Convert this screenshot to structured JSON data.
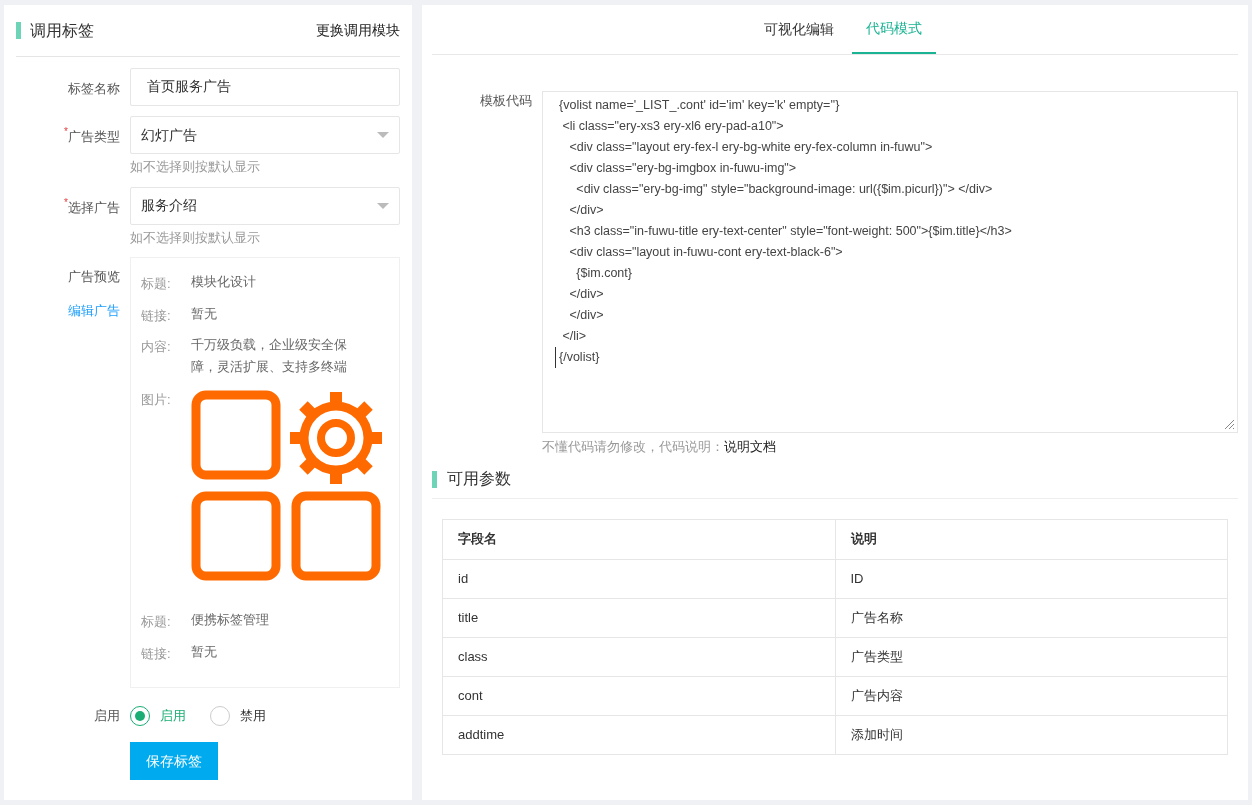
{
  "left_panel": {
    "title": "调用标签",
    "switch_link": "更换调用模块",
    "fields": [
      {
        "kind": "input",
        "label": "标签名称",
        "value": "首页服务广告"
      },
      {
        "kind": "select",
        "label": "广告类型",
        "mark": "*",
        "value": "幻灯广告",
        "hint": "如不选择则按默认显示"
      },
      {
        "kind": "select",
        "label": "选择广告",
        "mark": "*",
        "value": "服务介绍",
        "hint": "如不选择则按默认显示"
      }
    ],
    "preview": {
      "label": "广告预览",
      "edit_link": "编辑广告",
      "items": [
        {
          "kind": "text",
          "label": "标题:",
          "value": "模块化设计"
        },
        {
          "kind": "text",
          "label": "链接:",
          "value": "暂无"
        },
        {
          "kind": "text",
          "label": "内容:",
          "value": "千万级负载，企业级安全保障，灵活扩展、支持多终端"
        },
        {
          "kind": "image",
          "label": "图片:"
        },
        {
          "kind": "text",
          "label": "标题:",
          "value": "便携标签管理"
        },
        {
          "kind": "text",
          "label": "链接:",
          "value": "暂无"
        }
      ]
    },
    "status": {
      "label": "启用",
      "options": [
        {
          "label": "启用",
          "selected": true
        },
        {
          "label": "禁用",
          "selected": false
        }
      ]
    },
    "save_button": "保存标签"
  },
  "right_panel": {
    "tabs": [
      {
        "label": "可视化编辑",
        "selected": false
      },
      {
        "label": "代码模式",
        "selected": true
      }
    ],
    "code_label": "模板代码",
    "code_lines": [
      "{volist name='_LIST_.cont' id='im' key='k' empty=''}",
      " <li class=\"ery-xs3 ery-xl6 ery-pad-a10\">",
      "   <div class=\"layout ery-fex-l ery-bg-white ery-fex-column in-fuwu\">",
      "   <div class=\"ery-bg-imgbox in-fuwu-img\">",
      "     <div class=\"ery-bg-img\" style=\"background-image: url({$im.picurl})\"> </div>",
      "   </div>",
      "   <h3 class=\"in-fuwu-title ery-text-center\" style=\"font-weight: 500\">{$im.title}</h3>",
      "   <div class=\"layout in-fuwu-cont ery-text-black-6\">",
      "     {$im.cont}",
      "   </div>",
      "   </div>",
      " </li>",
      "{/volist}"
    ],
    "code_note": "不懂代码请勿修改，代码说明：",
    "doc_link": "说明文档",
    "params_title": "可用参数",
    "table": {
      "columns": [
        "字段名",
        "说明"
      ],
      "rows": [
        [
          "id",
          "ID"
        ],
        [
          "title",
          "广告名称"
        ],
        [
          "class",
          "广告类型"
        ],
        [
          "cont",
          "广告内容"
        ],
        [
          "addtime",
          "添加时间"
        ]
      ]
    }
  }
}
